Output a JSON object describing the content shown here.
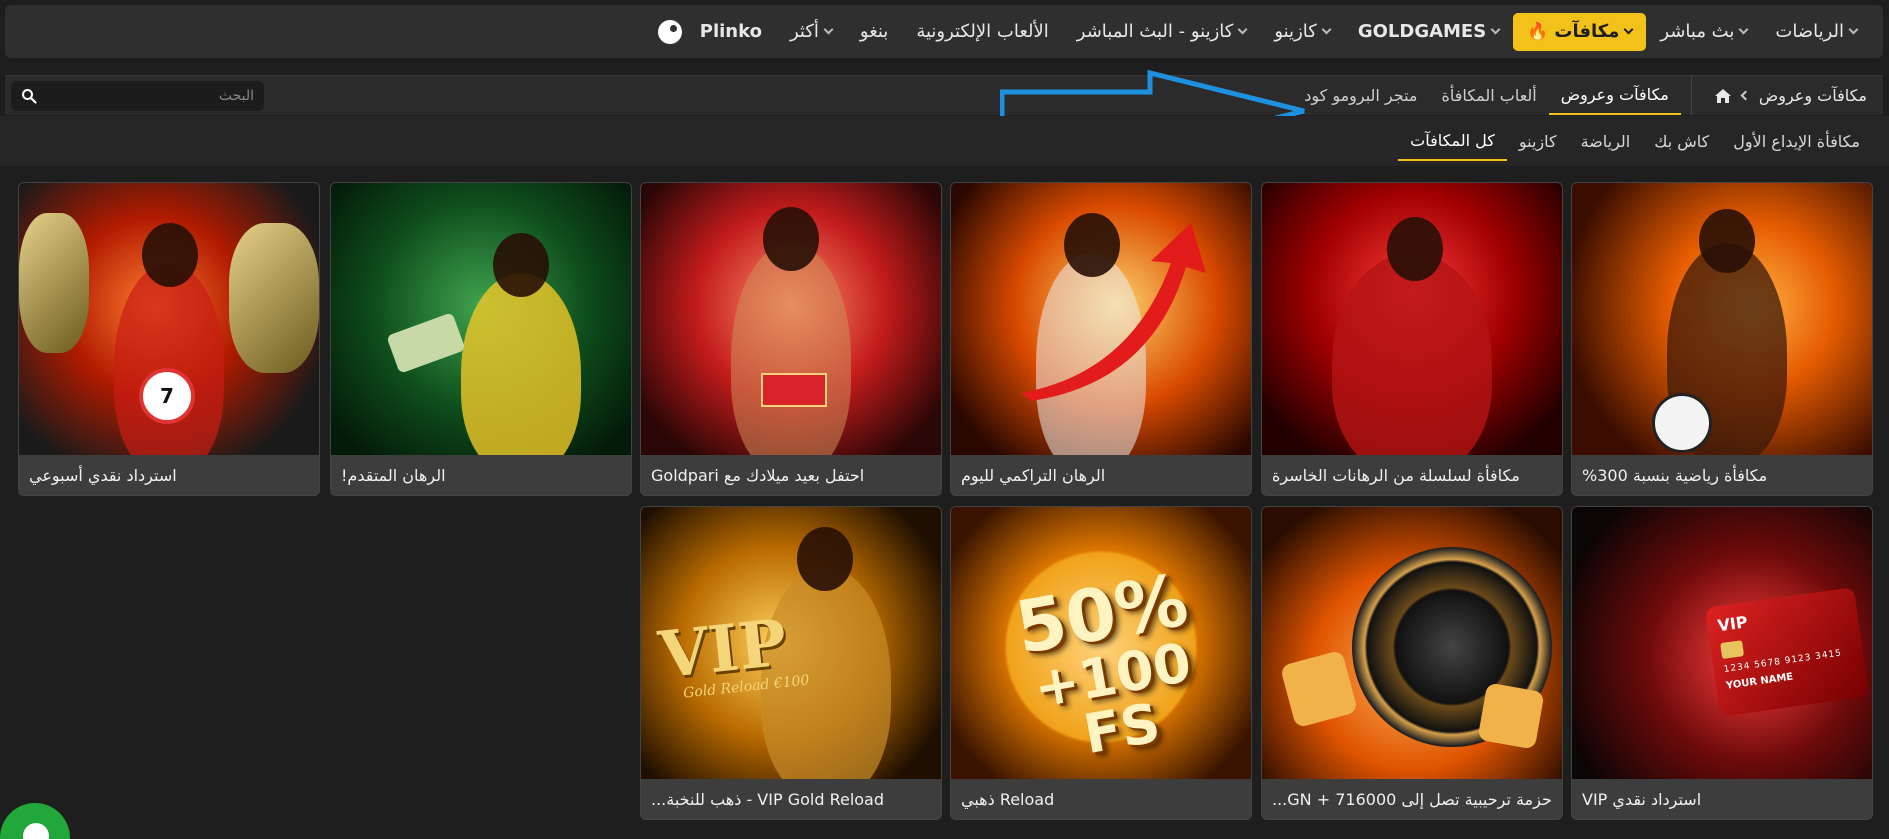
{
  "topnav": {
    "items": [
      {
        "label": "الرياضات",
        "chevron": true
      },
      {
        "label": "بث مباشر",
        "chevron": true
      },
      {
        "label": "مكافآت",
        "chevron": true,
        "active": true,
        "icon": "flame-icon"
      },
      {
        "label": "GOLDGAMES",
        "chevron": true,
        "bold": true
      },
      {
        "label": "كازينو",
        "chevron": true
      },
      {
        "label": "كازينو - البث المباشر",
        "chevron": true
      },
      {
        "label": "الألعاب الإلكترونية",
        "chevron": false
      },
      {
        "label": "بنغو",
        "chevron": false
      },
      {
        "label": "أكثر",
        "chevron": true
      },
      {
        "label": "Plinko",
        "chevron": false,
        "bold": true,
        "icon": "plinko-ball-icon"
      }
    ],
    "accent": "#f2c21b"
  },
  "breadcrumb": {
    "label": "مكافآت وعروض"
  },
  "subtabs": [
    {
      "label": "مكافآت وعروض",
      "active": true
    },
    {
      "label": "ألعاب المكافأة",
      "active": false
    },
    {
      "label": "متجر البرومو كود",
      "active": false
    }
  ],
  "search": {
    "placeholder": "البحث"
  },
  "filters": [
    {
      "label": "مكافأة الإيداع الأول",
      "active": false
    },
    {
      "label": "كاش بك",
      "active": false
    },
    {
      "label": "الرياضة",
      "active": false
    },
    {
      "label": "كازينو",
      "active": false
    },
    {
      "label": "كل المكافآت",
      "active": true
    }
  ],
  "cards": [
    {
      "caption": "مكافأة رياضية بنسبة 300%"
    },
    {
      "caption": "مكافأة لسلسلة من الرهانات الخاسرة"
    },
    {
      "caption": "الرهان التراكمي لليوم"
    },
    {
      "caption": "احتفل بعيد ميلادك مع Goldpari"
    },
    {
      "caption": "الرهان المتقدم!"
    },
    {
      "caption": "استرداد نقدي أسبوعي",
      "badge": "7"
    },
    {
      "caption": "استرداد نقدي VIP",
      "card_vip": "VIP",
      "card_number": "1234 5678 9123 3415",
      "card_name": "YOUR NAME"
    },
    {
      "caption": "حزمة ترحيبية تصل إلى 716000 + GN..."
    },
    {
      "caption": "Reload ذهبي",
      "promo_line1": "50%",
      "promo_line2": "+100 FS"
    },
    {
      "caption": "VIP Gold Reload - ذهب للنخبة...",
      "vip_title": "VIP",
      "vip_sub": "Gold Reload €100"
    }
  ]
}
